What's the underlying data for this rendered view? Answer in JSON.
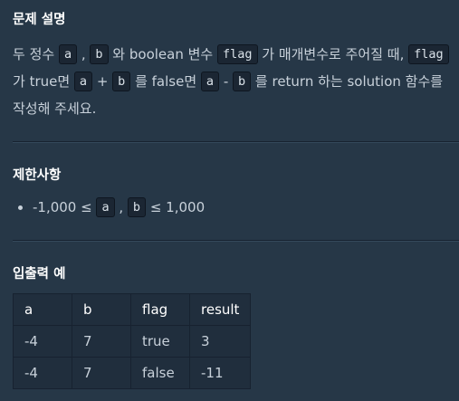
{
  "sections": {
    "description_title": "문제 설명",
    "limits_title": "제한사항",
    "examples_title": "입출력 예"
  },
  "description": {
    "l1_t1": "두 정수 ",
    "l1_c1": "a",
    "l1_t2": " , ",
    "l1_c2": "b",
    "l1_t3": " 와 boolean 변수 ",
    "l1_c3": "flag",
    "l1_t4": " 가 매개변수로 주어질 때, ",
    "l1_c4": "flag",
    "l2_t1": "가 true면 ",
    "l2_c1": "a",
    "l2_t2": " + ",
    "l2_c2": "b",
    "l2_t3": " 를 false면 ",
    "l2_c3": "a",
    "l2_t4": " - ",
    "l2_c4": "b",
    "l2_t5": " 를 return 하는 solution 함수를",
    "l3_t1": "작성해 주세요."
  },
  "limits": {
    "item1_t1": "-1,000 ≤ ",
    "item1_c1": "a",
    "item1_t2": " , ",
    "item1_c2": "b",
    "item1_t3": " ≤ 1,000"
  },
  "examples_table": {
    "headers": [
      "a",
      "b",
      "flag",
      "result"
    ],
    "rows": [
      [
        "-4",
        "7",
        "true",
        "3"
      ],
      [
        "-4",
        "7",
        "false",
        "-11"
      ]
    ]
  }
}
